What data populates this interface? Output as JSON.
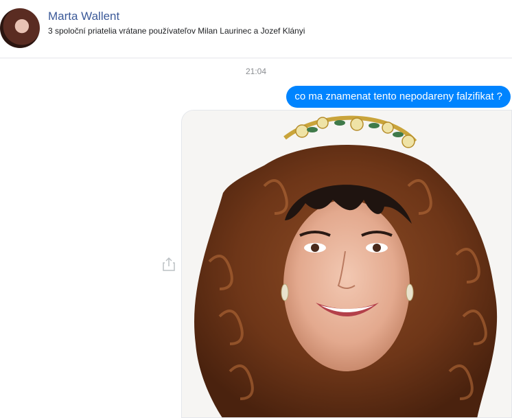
{
  "header": {
    "contact_name": "Marta Wallent",
    "subtitle": "3 spoloční priatelia vrátane používateľov Milan Laurinec a Jozef Klányi"
  },
  "conversation": {
    "timestamp": "21:04",
    "messages": [
      {
        "type": "text",
        "sender": "me",
        "text": "co ma znamenat tento nepodareny falzifikat ?"
      },
      {
        "type": "image",
        "sender": "me"
      }
    ]
  },
  "icons": {
    "share": "share-icon"
  },
  "colors": {
    "accent": "#0084ff",
    "name": "#3b5998",
    "timestamp": "#8a8d91"
  }
}
